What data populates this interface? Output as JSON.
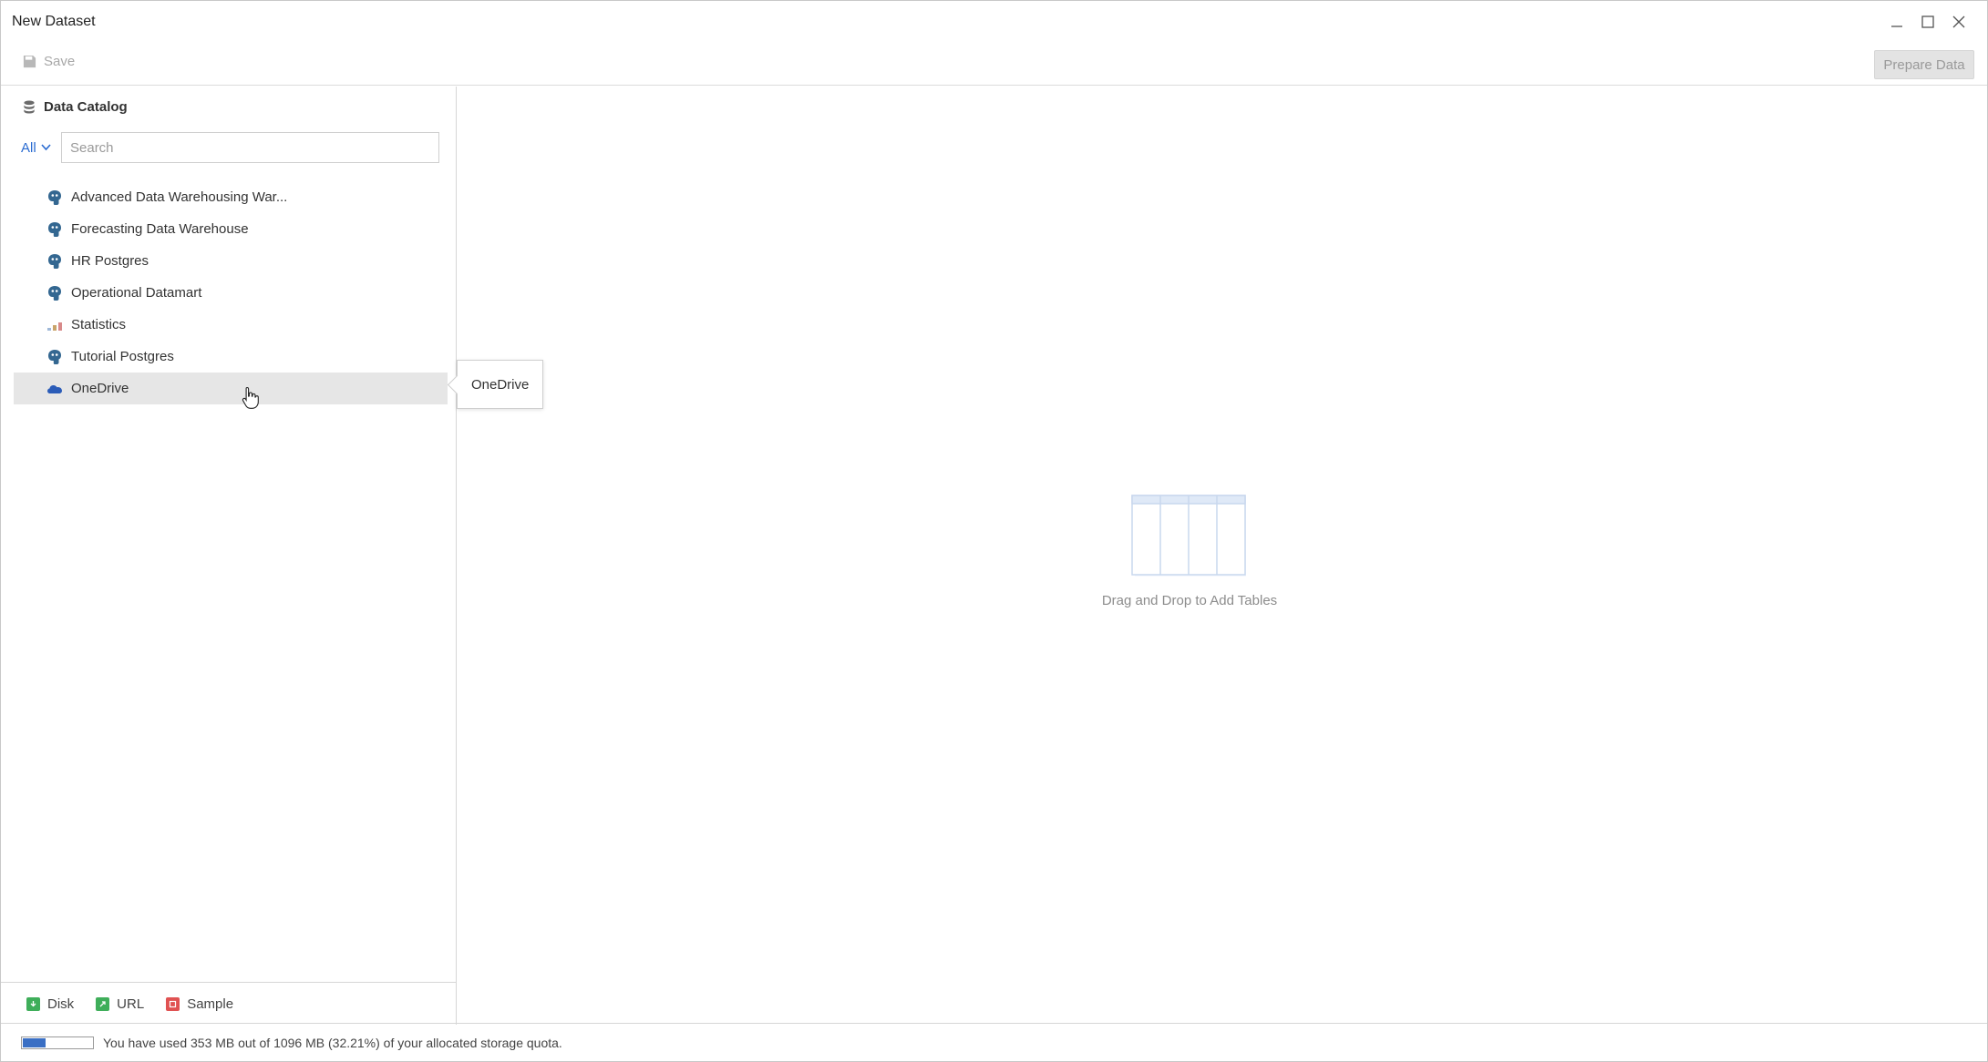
{
  "window": {
    "title": "New Dataset",
    "controls": [
      "minimize-icon",
      "maximize-icon",
      "close-icon"
    ]
  },
  "toolbar": {
    "save_label": "Save",
    "prepare_label": "Prepare Data"
  },
  "catalog": {
    "header": "Data Catalog",
    "filter_label": "All",
    "search_placeholder": "Search",
    "items": [
      {
        "label": "Advanced Data Warehousing War...",
        "icon": "postgres-icon"
      },
      {
        "label": "Forecasting Data Warehouse",
        "icon": "postgres-icon"
      },
      {
        "label": "HR Postgres",
        "icon": "postgres-icon"
      },
      {
        "label": "Operational Datamart",
        "icon": "postgres-icon"
      },
      {
        "label": "Statistics",
        "icon": "statistics-icon"
      },
      {
        "label": "Tutorial Postgres",
        "icon": "postgres-icon"
      },
      {
        "label": "OneDrive",
        "icon": "onedrive-icon",
        "selected": true
      }
    ],
    "tooltip": "OneDrive"
  },
  "footer": {
    "disk_label": "Disk",
    "url_label": "URL",
    "sample_label": "Sample"
  },
  "canvas": {
    "empty_text": "Drag and Drop to Add Tables"
  },
  "status": {
    "quota_text": "You have used 353 MB out of 1096 MB (32.21%) of your allocated storage quota.",
    "quota_fraction": 0.3221
  },
  "colors": {
    "accent": "#2a6bd1",
    "quota_fill": "#3a6fc4",
    "disk": "#3fae5a",
    "url": "#3fae5a",
    "sample": "#e05252"
  }
}
